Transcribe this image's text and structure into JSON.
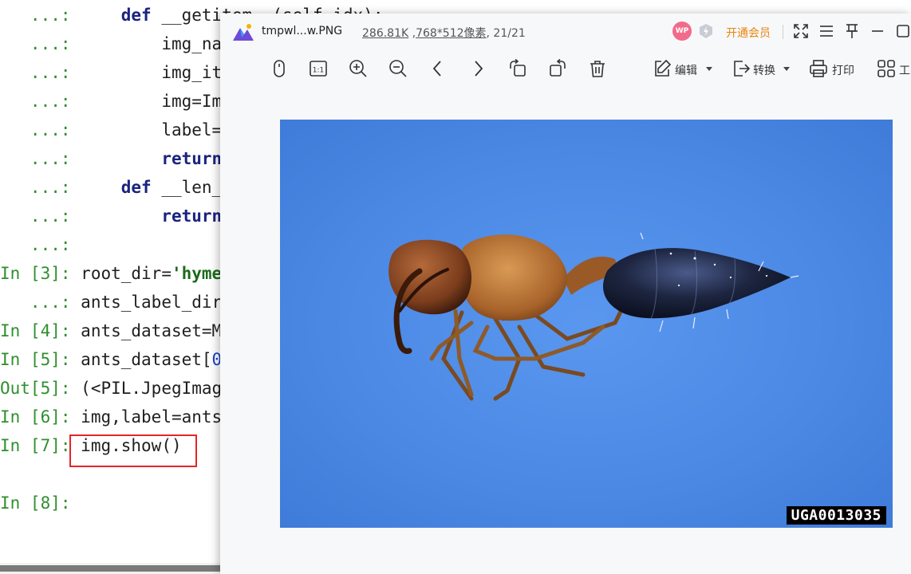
{
  "console": {
    "lines": [
      {
        "prompt": "   ...:",
        "indent": "     ",
        "kw": "def",
        "code": " __getitem__(self,idx):"
      },
      {
        "prompt": "   ...:",
        "indent": "         ",
        "kw": "",
        "code": "img_na"
      },
      {
        "prompt": "   ...:",
        "indent": "         ",
        "kw": "",
        "code": "img_it"
      },
      {
        "prompt": "   ...:",
        "indent": "         ",
        "kw": "",
        "code": "img=Im"
      },
      {
        "prompt": "   ...:",
        "indent": "         ",
        "kw": "",
        "code": "label="
      },
      {
        "prompt": "   ...:",
        "indent": "         ",
        "kw": "return",
        "code": ""
      },
      {
        "prompt": "   ...:",
        "indent": "     ",
        "kw": "def",
        "code": " __len_"
      },
      {
        "prompt": "   ...:",
        "indent": "         ",
        "kw": "return",
        "code": ""
      },
      {
        "prompt": "   ...:",
        "indent": "",
        "kw": "",
        "code": ""
      },
      {
        "prompt": "In [3]:",
        "indent": " ",
        "kw": "",
        "code": "root_dir=",
        "str": "'hyme"
      },
      {
        "prompt": "   ...:",
        "indent": " ",
        "kw": "",
        "code": "ants_label_dir"
      },
      {
        "prompt": "In [4]:",
        "indent": " ",
        "kw": "",
        "code": "ants_dataset=M"
      },
      {
        "prompt": "In [5]:",
        "indent": " ",
        "kw": "",
        "code": "ants_dataset[",
        "num": "0"
      },
      {
        "prompt": "Out[5]:",
        "indent": " ",
        "kw": "",
        "code": "(<PIL.JpegImag"
      },
      {
        "prompt": "In [6]:",
        "indent": " ",
        "kw": "",
        "code": "img,label=ants"
      },
      {
        "prompt": "In [7]:",
        "indent": " ",
        "kw": "",
        "code": "img.show()"
      },
      {
        "prompt": "",
        "indent": "",
        "kw": "",
        "code": ""
      },
      {
        "prompt": "In [8]:",
        "indent": "",
        "kw": "",
        "code": ""
      }
    ]
  },
  "viewer": {
    "file_name": "tmpwl...w.PNG",
    "file_size": "286.81K",
    "file_dims": "768*512像素",
    "page_counter": ", 21/21",
    "avatar_text": "WP",
    "vip_label": "开通会员",
    "toolbar": {
      "edit_label": "编辑",
      "convert_label": "转换",
      "print_label": "打印",
      "tools_label": "工"
    },
    "image": {
      "watermark": "UGA0013035",
      "subject": "ant specimen on blue background"
    }
  },
  "colors": {
    "prompt_green": "#2f8f2f",
    "keyword_navy": "#1a237e",
    "highlight_red": "#e32626",
    "vip_orange": "#e8850c",
    "image_blue": "#4a88e4"
  }
}
